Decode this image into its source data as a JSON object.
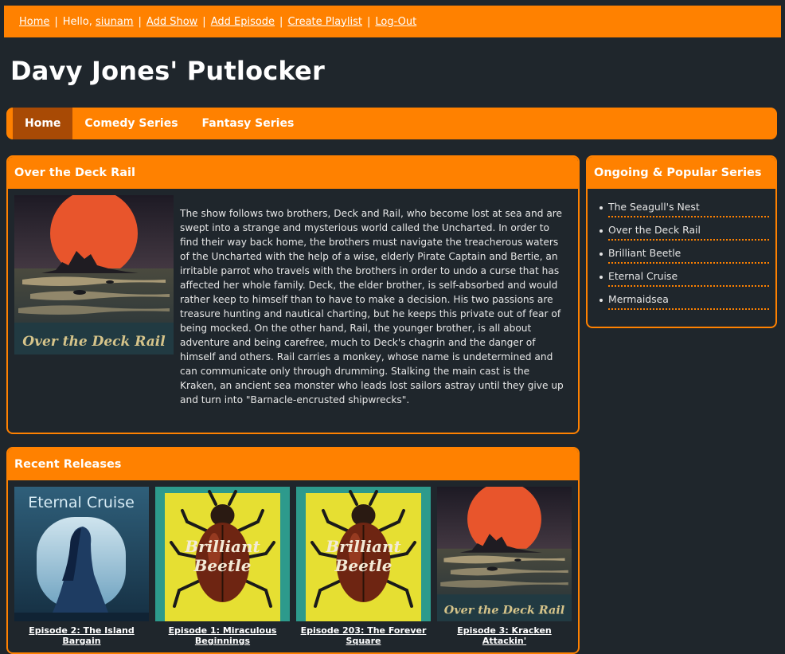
{
  "topbar": {
    "home": "Home",
    "greeting": "Hello,",
    "username": "siunam",
    "add_show": "Add Show",
    "add_episode": "Add Episode",
    "create_playlist": "Create Playlist",
    "logout": "Log-Out",
    "separator": "|"
  },
  "site_title": "Davy Jones' Putlocker",
  "nav": {
    "items": [
      {
        "label": "Home",
        "active": true
      },
      {
        "label": "Comedy Series"
      },
      {
        "label": "Fantasy Series"
      }
    ]
  },
  "show": {
    "title": "Over the Deck Rail",
    "poster_text": "Over the Deck Rail",
    "description": "The show follows two brothers, Deck and Rail, who become lost at sea and are swept into a strange and mysterious world called the Uncharted. In order to find their way back home, the brothers must navigate the treacherous waters of the Uncharted with the help of a wise, elderly Pirate Captain and Bertie, an irritable parrot who travels with the brothers in order to undo a curse that has affected her whole family. Deck, the elder brother, is self-absorbed and would rather keep to himself than to have to make a decision. His two passions are treasure hunting and nautical charting, but he keeps this private out of fear of being mocked. On the other hand, Rail, the younger brother, is all about adventure and being carefree, much to Deck's chagrin and the danger of himself and others. Rail carries a monkey, whose name is undetermined and can communicate only through drumming. Stalking the main cast is the Kraken, an ancient sea monster who leads lost sailors astray until they give up and turn into \"Barnacle-encrusted shipwrecks\"."
  },
  "sidebar": {
    "title": "Ongoing & Popular Series",
    "items": [
      "The Seagull's Nest",
      "Over the Deck Rail",
      "Brilliant Beetle",
      "Eternal Cruise",
      "Mermaidsea"
    ]
  },
  "recent": {
    "title": "Recent Releases",
    "items": [
      {
        "title": "Episode 2: The Island Bargain",
        "thumb_text": "Eternal Cruise"
      },
      {
        "title": "Episode 1: Miraculous Beginnings",
        "thumb_text_1": "Brilliant",
        "thumb_text_2": "Beetle"
      },
      {
        "title": "Episode 203: The Forever Square",
        "thumb_text_1": "Brilliant",
        "thumb_text_2": "Beetle"
      },
      {
        "title": "Episode 3: Kracken Attackin'",
        "thumb_text": "Over the Deck Rail"
      }
    ]
  },
  "colors": {
    "accent": "#ff8100",
    "active_nav": "#a84a05",
    "background": "#1f262c"
  }
}
